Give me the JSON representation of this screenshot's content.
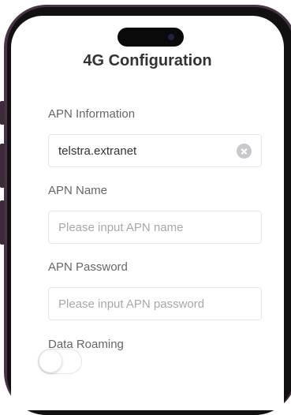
{
  "page": {
    "title": "4G Configuration"
  },
  "apn_information": {
    "label": "APN Information",
    "value": "telstra.extranet",
    "clear_icon": "clear-circle-icon"
  },
  "apn_name": {
    "label": "APN Name",
    "placeholder": "Please input APN name"
  },
  "apn_password": {
    "label": "APN Password",
    "placeholder": "Please input APN password"
  },
  "data_roaming": {
    "label": "Data Roaming",
    "enabled": false
  },
  "colors": {
    "frame": "#4a3346",
    "title_text": "#333333",
    "label_text": "#666666",
    "placeholder_text": "#a8a8a8",
    "border": "#e5e5e5"
  }
}
